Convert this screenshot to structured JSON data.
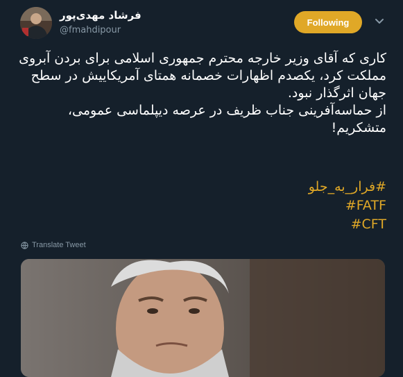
{
  "header": {
    "display_name": "فرشاد مهدی‌پور",
    "handle": "@fmahdipour",
    "follow_label": "Following"
  },
  "tweet": {
    "paragraph1": "کاری که آقای وزیر خارجه محترم جمهوری اسلامی برای بردن آبروی مملکت کرد، یکصدم اظهارات خصمانه همتای آمریکاییش در سطح جهان اثرگذار نبود.",
    "paragraph2": "از حماسه‌آفرینی جناب ظریف در عرصه دیپلماسی عمومی، متشکریم!",
    "hashtags": [
      "#فرار_به_جلو",
      "#FATF",
      "#CFT"
    ],
    "translate_label": "Translate Tweet"
  },
  "icons": {
    "chevron": "chevron-down-icon",
    "globe": "globe-icon"
  },
  "colors": {
    "background": "#15202b",
    "accent": "#e0a827",
    "secondary_text": "#8899a6"
  }
}
